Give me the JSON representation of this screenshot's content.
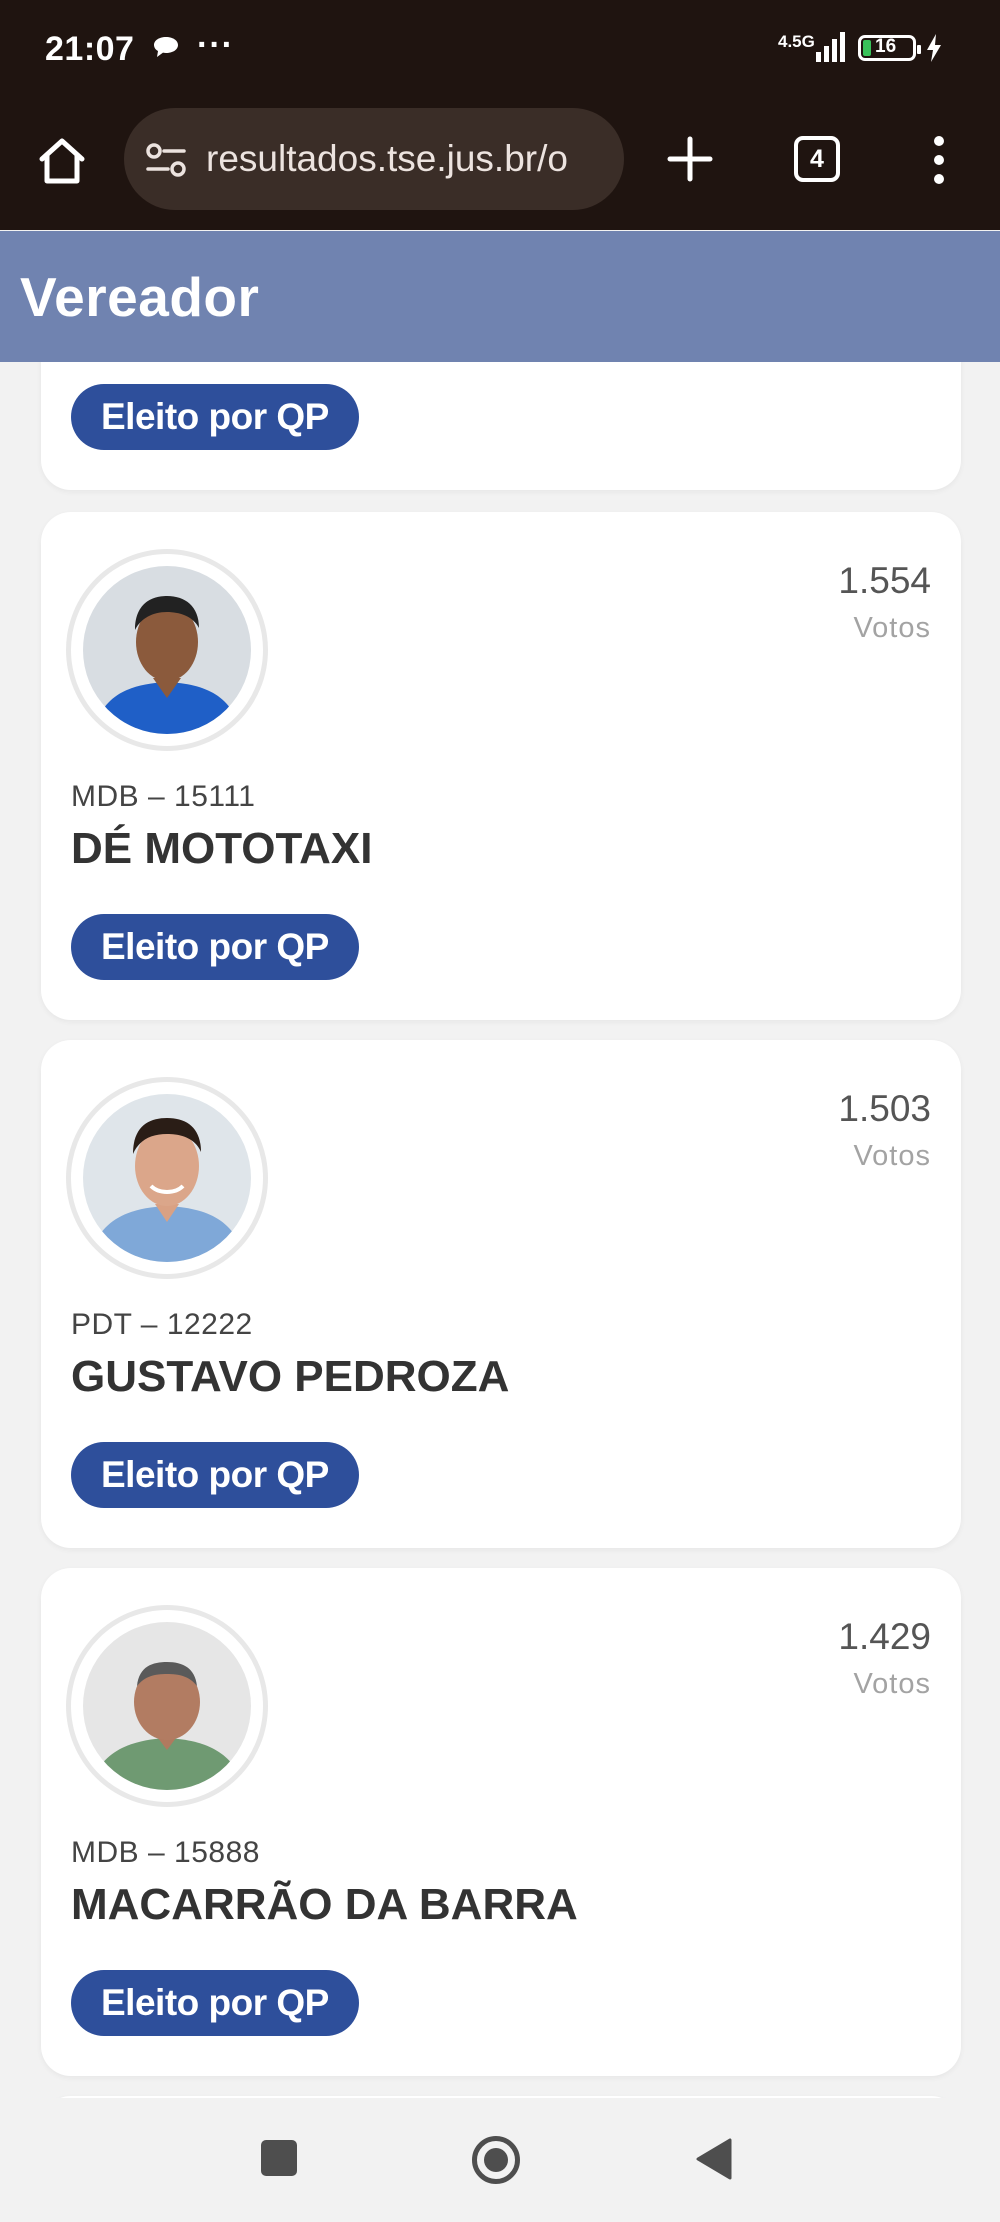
{
  "status_bar": {
    "time": "21:07",
    "network": "4.5G",
    "battery": "16",
    "icons": [
      "chat-bubble-icon",
      "more-dots-icon",
      "signal-icon",
      "battery-icon",
      "charging-icon"
    ]
  },
  "browser": {
    "url": "resultados.tse.jus.br/o",
    "tab_count": "4",
    "icons": [
      "home-icon",
      "site-settings-icon",
      "plus-icon",
      "tabs-icon",
      "overflow-menu-icon"
    ]
  },
  "header": {
    "title": "Vereador",
    "color": "#7083b0"
  },
  "colors": {
    "badge": "#2e4f9b",
    "card": "#ffffff",
    "background": "#f2f2f2"
  },
  "previous_card": {
    "status": "Eleito por QP"
  },
  "candidates": [
    {
      "party_number": "MDB – 15111",
      "name": "DÉ MOTOTAXI",
      "votes": "1.554",
      "votes_label": "Votos",
      "status": "Eleito por QP"
    },
    {
      "party_number": "PDT – 12222",
      "name": "GUSTAVO PEDROZA",
      "votes": "1.503",
      "votes_label": "Votos",
      "status": "Eleito por QP"
    },
    {
      "party_number": "MDB – 15888",
      "name": "MACARRÃO DA BARRA",
      "votes": "1.429",
      "votes_label": "Votos",
      "status": "Eleito por QP"
    }
  ],
  "nav_bar": {
    "icons": [
      "recents-square-icon",
      "home-circle-icon",
      "back-triangle-icon"
    ]
  }
}
